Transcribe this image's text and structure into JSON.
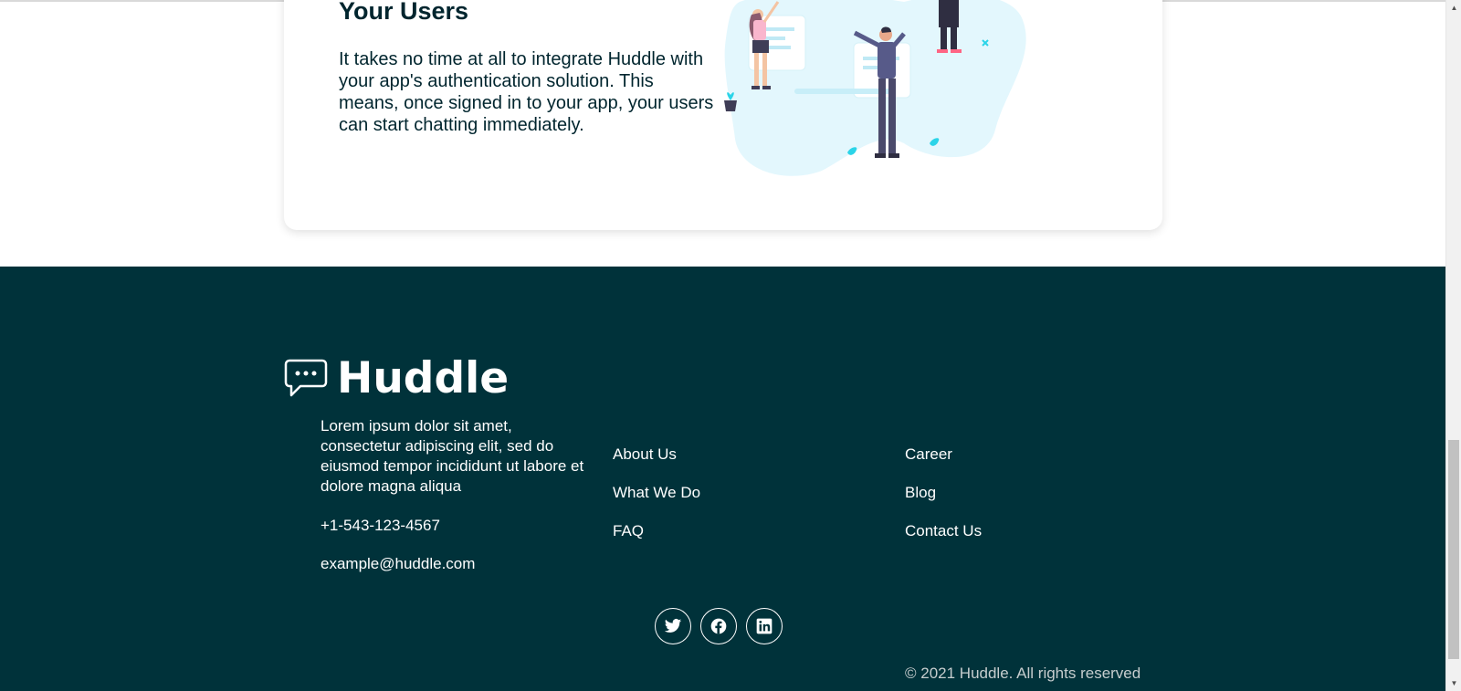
{
  "card": {
    "title": "Your Users",
    "text": "It takes no time at all to integrate Huddle with your app's authentication solution. This means, once signed in to your app, your users can start chatting immediately.",
    "illustration_icon": "people-chatting-illustration"
  },
  "footer": {
    "logo_text": "Huddle",
    "logo_icon": "chat-bubble-icon",
    "about": "Lorem ipsum dolor sit amet, consectetur adipiscing elit, sed do eiusmod tempor incididunt ut labore et dolore magna aliqua",
    "phone": "+1-543-123-4567",
    "email": "example@huddle.com",
    "links_col1": [
      "About Us",
      "What We Do",
      "FAQ"
    ],
    "links_col2": [
      "Career",
      "Blog",
      "Contact Us"
    ],
    "socials": [
      "twitter-icon",
      "facebook-icon",
      "linkedin-icon"
    ],
    "copyright": "© 2021 Huddle. All rights reserved"
  },
  "colors": {
    "footer_bg": "#00323a",
    "text_dark": "#00252e",
    "illustration_accent": "#e3f7fd"
  }
}
